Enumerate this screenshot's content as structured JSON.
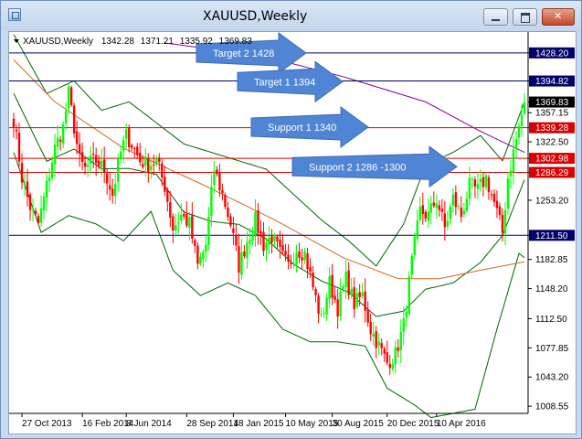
{
  "window": {
    "title": "XAUUSD,Weekly"
  },
  "info_bar": {
    "symbol_period": "XAUUSD,Weekly",
    "open": "1342.28",
    "high": "1371.21",
    "low": "1335.92",
    "close": "1369.83"
  },
  "colors": {
    "bull": "#00ff00",
    "bear": "#ff0000",
    "level_red": "#d80000",
    "level_navy": "#00006b",
    "ma_purple": "#8b008b",
    "ma_orange": "#d2691e",
    "bands": "#006400",
    "arrow": "#4f85d4"
  },
  "chart_data": {
    "type": "candlestick",
    "title": "XAUUSD,Weekly",
    "y_range": [
      1000,
      1453
    ],
    "y_ticks": [
      "1428.20",
      "1394.82",
      "1369.83",
      "1357.15",
      "1339.28",
      "1322.50",
      "1302.98",
      "1286.29",
      "1253.20",
      "1211.50",
      "1182.85",
      "1148.20",
      "1112.50",
      "1077.85",
      "1043.20",
      "1008.55"
    ],
    "x_labels": [
      "27 Oct 2013",
      "16 Feb 2014",
      "8 Jun 2014",
      "28 Sep 2014",
      "18 Jan 2015",
      "10 May 2015",
      "30 Aug 2015",
      "20 Dec 2015",
      "10 Apr 2016"
    ],
    "levels": [
      {
        "price": 1428.2,
        "label": "1428.20",
        "style": "navy"
      },
      {
        "price": 1394.82,
        "label": "1394.82",
        "style": "navy"
      },
      {
        "price": 1339.28,
        "label": "1339.28",
        "style": "red"
      },
      {
        "price": 1302.98,
        "label": "1302.98",
        "style": "red"
      },
      {
        "price": 1286.29,
        "label": "1286.29",
        "style": "red"
      },
      {
        "price": 1211.5,
        "label": "1211.50",
        "style": "navy"
      }
    ],
    "current_price": "1369.83",
    "annotations": [
      {
        "text": "Target 2 1428",
        "price": 1428
      },
      {
        "text": "Target 1 1394",
        "price": 1394
      },
      {
        "text": "Support  1 1340",
        "price": 1340
      },
      {
        "text": "Support 2  1286 -1300",
        "price": 1293
      }
    ],
    "price_path": [
      [
        0,
        1350
      ],
      [
        3,
        1280
      ],
      [
        6,
        1245
      ],
      [
        9,
        1225
      ],
      [
        12,
        1270
      ],
      [
        15,
        1315
      ],
      [
        18,
        1340
      ],
      [
        20,
        1380
      ],
      [
        22,
        1340
      ],
      [
        24,
        1300
      ],
      [
        26,
        1290
      ],
      [
        28,
        1298
      ],
      [
        30,
        1300
      ],
      [
        33,
        1290
      ],
      [
        36,
        1260
      ],
      [
        39,
        1310
      ],
      [
        41,
        1330
      ],
      [
        43,
        1320
      ],
      [
        46,
        1300
      ],
      [
        49,
        1295
      ],
      [
        52,
        1300
      ],
      [
        55,
        1270
      ],
      [
        58,
        1220
      ],
      [
        61,
        1235
      ],
      [
        64,
        1225
      ],
      [
        67,
        1175
      ],
      [
        70,
        1200
      ],
      [
        73,
        1290
      ],
      [
        76,
        1260
      ],
      [
        79,
        1225
      ],
      [
        82,
        1175
      ],
      [
        85,
        1205
      ],
      [
        88,
        1230
      ],
      [
        91,
        1200
      ],
      [
        94,
        1210
      ],
      [
        97,
        1190
      ],
      [
        100,
        1175
      ],
      [
        103,
        1195
      ],
      [
        106,
        1190
      ],
      [
        109,
        1150
      ],
      [
        112,
        1110
      ],
      [
        115,
        1155
      ],
      [
        118,
        1125
      ],
      [
        121,
        1160
      ],
      [
        124,
        1130
      ],
      [
        127,
        1140
      ],
      [
        130,
        1100
      ],
      [
        133,
        1080
      ],
      [
        136,
        1060
      ],
      [
        139,
        1070
      ],
      [
        142,
        1105
      ],
      [
        145,
        1180
      ],
      [
        148,
        1240
      ],
      [
        151,
        1235
      ],
      [
        154,
        1255
      ],
      [
        157,
        1220
      ],
      [
        160,
        1255
      ],
      [
        163,
        1235
      ],
      [
        166,
        1270
      ],
      [
        169,
        1265
      ],
      [
        172,
        1280
      ],
      [
        175,
        1250
      ],
      [
        178,
        1215
      ],
      [
        180,
        1280
      ],
      [
        182,
        1310
      ],
      [
        184,
        1340
      ],
      [
        186,
        1370
      ]
    ],
    "moving_averages": [
      {
        "color": "purple",
        "points": [
          [
            55,
            1440
          ],
          [
            90,
            1425
          ],
          [
            120,
            1400
          ],
          [
            150,
            1370
          ],
          [
            170,
            1335
          ],
          [
            186,
            1310
          ]
        ]
      },
      {
        "color": "orange",
        "points": [
          [
            0,
            1420
          ],
          [
            15,
            1370
          ],
          [
            40,
            1315
          ],
          [
            70,
            1270
          ],
          [
            95,
            1230
          ],
          [
            120,
            1185
          ],
          [
            140,
            1160
          ],
          [
            155,
            1160
          ],
          [
            170,
            1170
          ],
          [
            186,
            1180
          ]
        ]
      }
    ],
    "bollinger_upper": [
      [
        0,
        1450
      ],
      [
        12,
        1380
      ],
      [
        22,
        1395
      ],
      [
        32,
        1360
      ],
      [
        42,
        1370
      ],
      [
        52,
        1345
      ],
      [
        62,
        1320
      ],
      [
        72,
        1310
      ],
      [
        82,
        1300
      ],
      [
        92,
        1290
      ],
      [
        102,
        1260
      ],
      [
        112,
        1230
      ],
      [
        122,
        1205
      ],
      [
        132,
        1175
      ],
      [
        142,
        1225
      ],
      [
        150,
        1295
      ],
      [
        160,
        1310
      ],
      [
        170,
        1330
      ],
      [
        178,
        1300
      ],
      [
        186,
        1370
      ]
    ],
    "bollinger_lower": [
      [
        0,
        1310
      ],
      [
        10,
        1215
      ],
      [
        20,
        1235
      ],
      [
        30,
        1225
      ],
      [
        40,
        1205
      ],
      [
        50,
        1240
      ],
      [
        58,
        1170
      ],
      [
        68,
        1140
      ],
      [
        78,
        1155
      ],
      [
        88,
        1140
      ],
      [
        98,
        1100
      ],
      [
        108,
        1085
      ],
      [
        118,
        1085
      ],
      [
        128,
        1080
      ],
      [
        136,
        1030
      ],
      [
        146,
        1010
      ],
      [
        152,
        995
      ],
      [
        160,
        1000
      ],
      [
        168,
        1005
      ],
      [
        176,
        1100
      ],
      [
        184,
        1190
      ],
      [
        186,
        1185
      ]
    ]
  }
}
